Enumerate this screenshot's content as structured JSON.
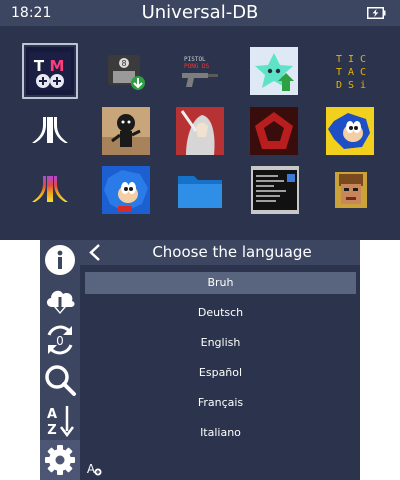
{
  "status_bar": {
    "time": "18:21",
    "title": "Universal-DB",
    "battery_icon": "battery-charging-icon"
  },
  "grid": {
    "selected_index": 0,
    "tiles": [
      {
        "icon": "tm-app-icon",
        "text": [
          "T",
          "M"
        ]
      },
      {
        "icon": "floppy-install-icon",
        "text": [
          "8"
        ]
      },
      {
        "icon": "pistol-pong-icon",
        "text": [
          "PISTOL",
          "PONG DS"
        ]
      },
      {
        "icon": "star-creature-icon"
      },
      {
        "icon": "tic-tac-dsi-icon",
        "text": [
          "T I C",
          "T A C",
          "D S i"
        ]
      },
      {
        "icon": "atari-logo-icon"
      },
      {
        "icon": "stick-figure-icon"
      },
      {
        "icon": "silver-knight-icon"
      },
      {
        "icon": "red-pentagon-icon"
      },
      {
        "icon": "sonic-icon"
      },
      {
        "icon": "atari-rainbow-icon"
      },
      {
        "icon": "sonic-blue-icon"
      },
      {
        "icon": "folder-icon"
      },
      {
        "icon": "terminal-icon"
      },
      {
        "icon": "doom-face-icon"
      }
    ]
  },
  "rail": {
    "items": [
      {
        "icon": "info-icon"
      },
      {
        "icon": "cloud-download-icon"
      },
      {
        "icon": "refresh-icon",
        "badge": "0"
      },
      {
        "icon": "search-icon"
      },
      {
        "icon": "sort-az-icon",
        "letters": [
          "A",
          "Z"
        ]
      },
      {
        "icon": "gear-icon",
        "active": true
      }
    ]
  },
  "header": {
    "title": "Choose the language",
    "back_icon": "chevron-left-icon"
  },
  "languages": {
    "selected_index": 0,
    "items": [
      "Bruh",
      "Deutsch",
      "English",
      "Español",
      "Français",
      "Italiano"
    ]
  },
  "footer": {
    "font_icon": "font-size-icon",
    "font_icon_text": "A"
  },
  "colors": {
    "background": "#2b344c",
    "bar": "#3d4661",
    "selected_row": "#59647f",
    "rail_active": "#4d5775",
    "icon": "#ffffff"
  }
}
